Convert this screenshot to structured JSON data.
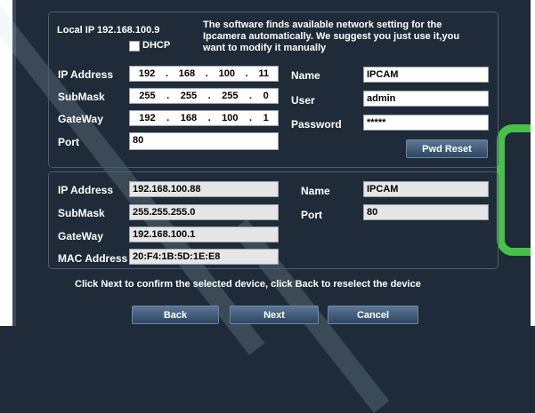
{
  "top": {
    "local_ip_label": "Local IP 192.168.100.9",
    "dhcp_label": "DHCP",
    "info_lines": [
      "The software finds available network setting for the",
      "Ipcamera automatically. We suggest you just use it,you",
      "want to modify it manually"
    ],
    "ip_label": "IP Address",
    "ip_parts": [
      "192",
      "168",
      "100",
      "11"
    ],
    "submask_label": "SubMask",
    "submask_parts": [
      "255",
      "255",
      "255",
      "0"
    ],
    "gateway_label": "GateWay",
    "gateway_parts": [
      "192",
      "168",
      "100",
      "1"
    ],
    "port_label": "Port",
    "port_value": "80",
    "name_label": "Name",
    "name_value": "IPCAM",
    "user_label": "User",
    "user_value": "admin",
    "password_label": "Password",
    "password_value": "*****",
    "pwd_reset_label": "Pwd Reset"
  },
  "device": {
    "ip_label": "IP Address",
    "ip_value": "192.168.100.88",
    "submask_label": "SubMask",
    "submask_value": "255.255.255.0",
    "gateway_label": "GateWay",
    "gateway_value": "192.168.100.1",
    "mac_label": "MAC Address",
    "mac_value": "20:F4:1B:5D:1E:E8",
    "name_label": "Name",
    "name_value": "IPCAM",
    "port_label": "Port",
    "port_value": "80"
  },
  "footer": {
    "instruction": "Click Next to confirm the selected device, click Back to reselect the device",
    "back_label": "Back",
    "next_label": "Next",
    "cancel_label": "Cancel"
  },
  "colors": {
    "background": "#1f2b38",
    "accent_green": "#48c04a",
    "button": "#3f5a78"
  }
}
